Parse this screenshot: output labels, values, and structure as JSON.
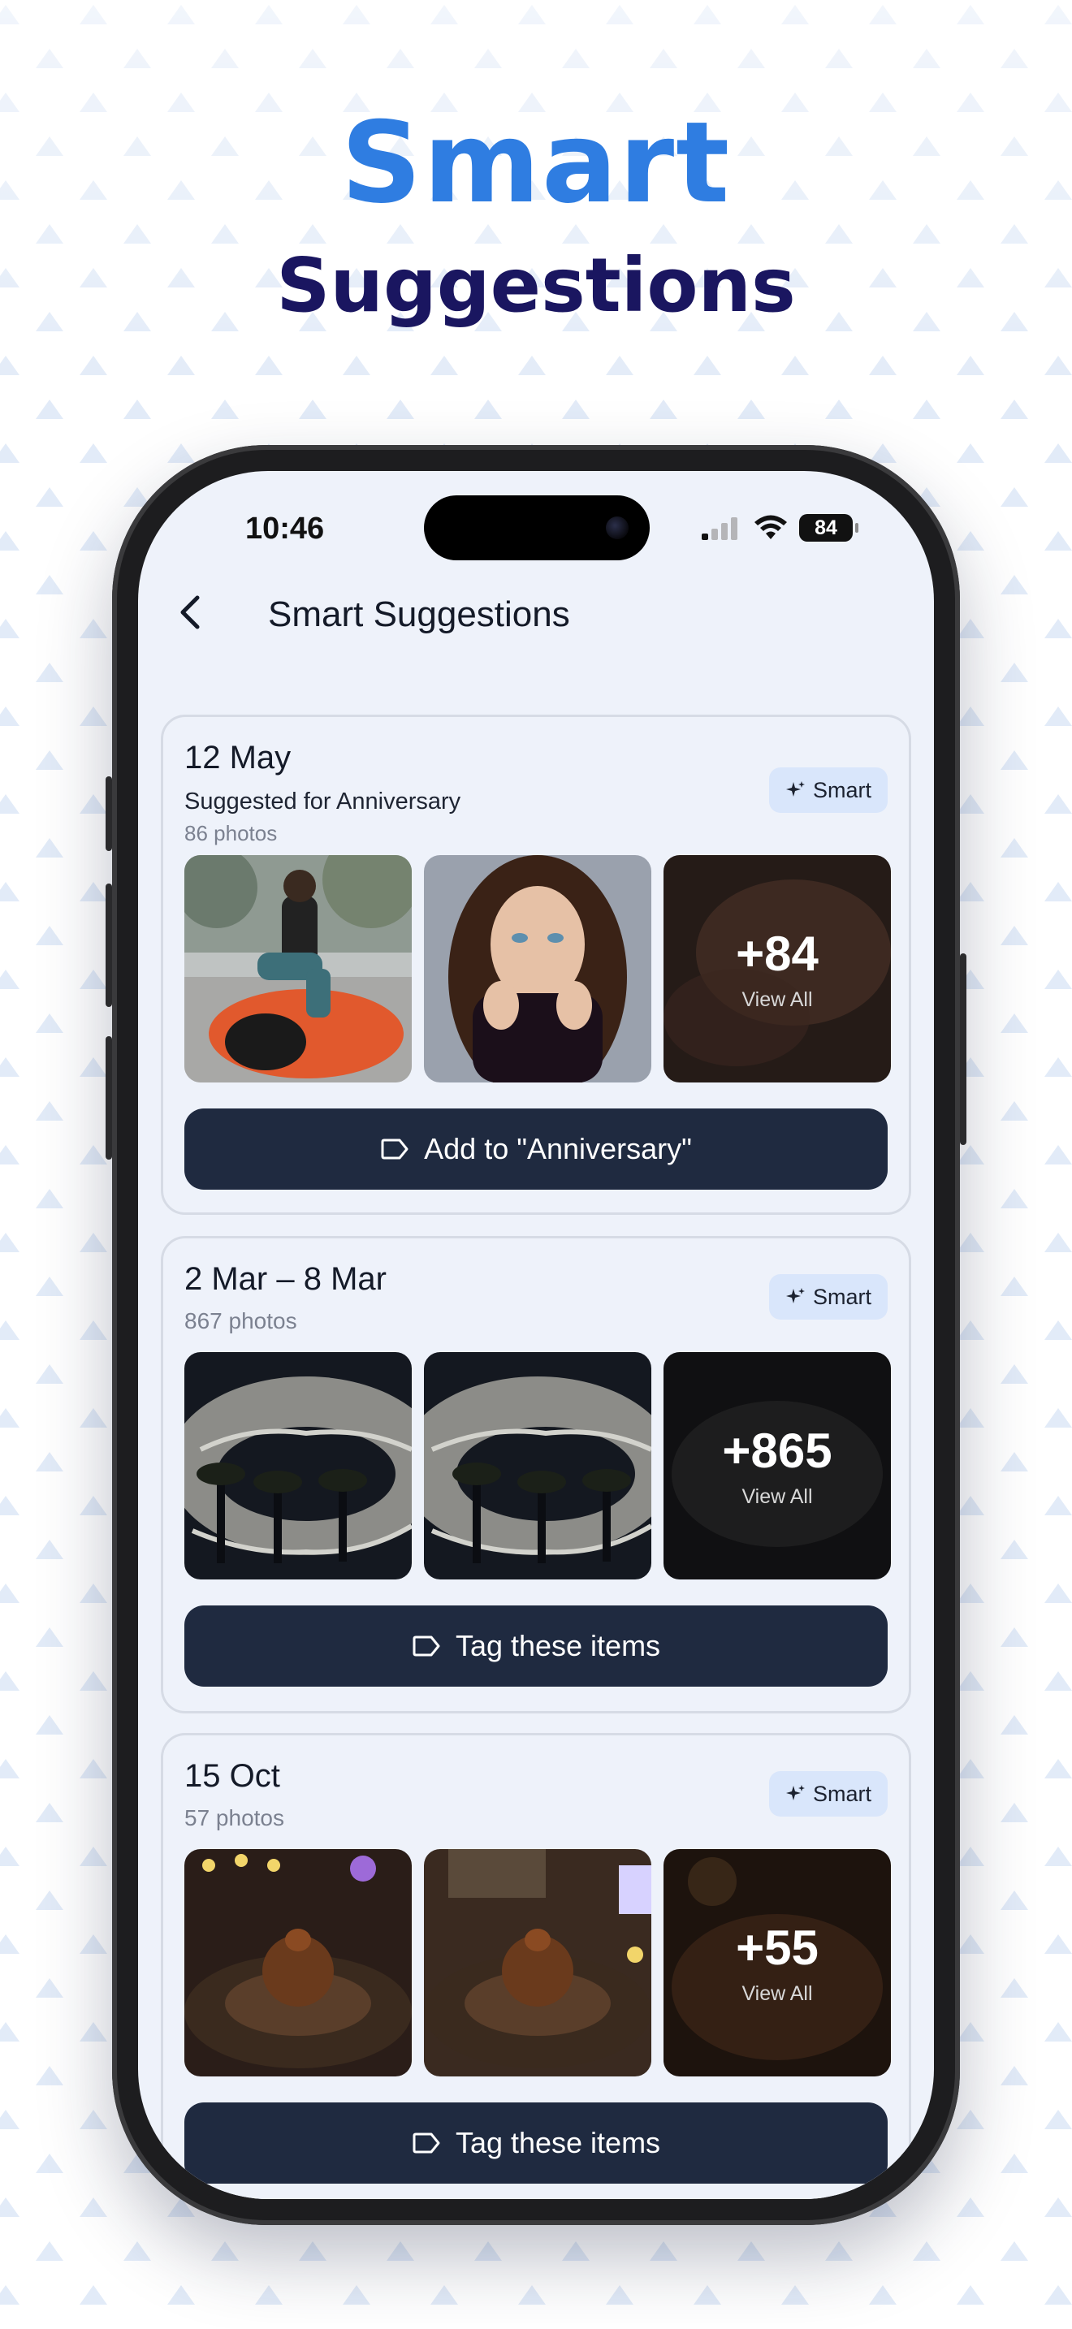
{
  "hero": {
    "title": "Smart",
    "subtitle": "Suggestions"
  },
  "status_bar": {
    "time": "10:46",
    "battery": "84"
  },
  "nav": {
    "title": "Smart Suggestions"
  },
  "cards": [
    {
      "date": "12 May",
      "suggestion": "Suggested for Anniversary",
      "count": "86 photos",
      "badge": "Smart",
      "more_count": "+84",
      "view_all": "View All",
      "action": "Add to \"Anniversary\""
    },
    {
      "date": "2 Mar – 8 Mar",
      "count": "867 photos",
      "badge": "Smart",
      "more_count": "+865",
      "view_all": "View All",
      "action": "Tag these items"
    },
    {
      "date": "15 Oct",
      "count": "57 photos",
      "badge": "Smart",
      "more_count": "+55",
      "view_all": "View All",
      "action": "Tag these items"
    }
  ],
  "icons": {
    "back": "chevron-left-icon",
    "smart": "sparkles-icon",
    "tag": "tag-icon",
    "signal": "cellular-signal-icon",
    "wifi": "wifi-icon",
    "battery": "battery-icon"
  },
  "colors": {
    "accent_blue": "#2f7de1",
    "navy": "#1a1660",
    "button_dark": "#1f2a40",
    "badge_bg": "#d9e6fb",
    "screen_bg": "#eef2fa"
  }
}
